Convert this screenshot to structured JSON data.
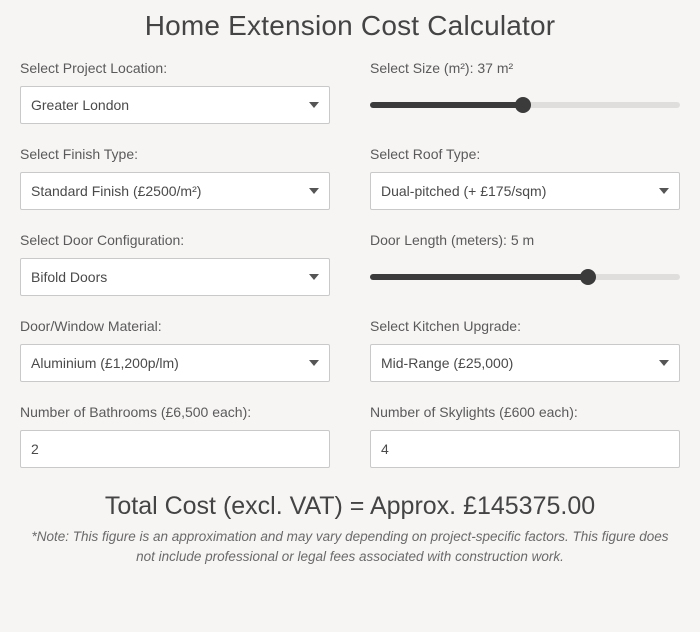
{
  "title": "Home Extension Cost Calculator",
  "fields": {
    "location": {
      "label": "Select Project Location:",
      "value": "Greater London"
    },
    "size": {
      "label": "Select Size (m²): 37 m²",
      "value": 37
    },
    "finish": {
      "label": "Select Finish Type:",
      "value": "Standard Finish (£2500/m²)"
    },
    "roof": {
      "label": "Select Roof Type:",
      "value": "Dual-pitched (+ £175/sqm)"
    },
    "door_config": {
      "label": "Select Door Configuration:",
      "value": "Bifold Doors"
    },
    "door_length": {
      "label": "Door Length (meters): 5 m",
      "value": 5
    },
    "material": {
      "label": "Door/Window Material:",
      "value": "Aluminium (£1,200p/lm)"
    },
    "kitchen": {
      "label": "Select Kitchen Upgrade:",
      "value": "Mid-Range (£25,000)"
    },
    "bathrooms": {
      "label": "Number of Bathrooms (£6,500 each):",
      "value": "2"
    },
    "skylights": {
      "label": "Number of Skylights (£600 each):",
      "value": "4"
    }
  },
  "total": {
    "label": "Total Cost (excl. VAT) = Approx. £145375.00"
  },
  "note": "*Note: This figure is an approximation and may vary depending on project-specific factors. This figure does not include professional or legal fees associated with construction work."
}
